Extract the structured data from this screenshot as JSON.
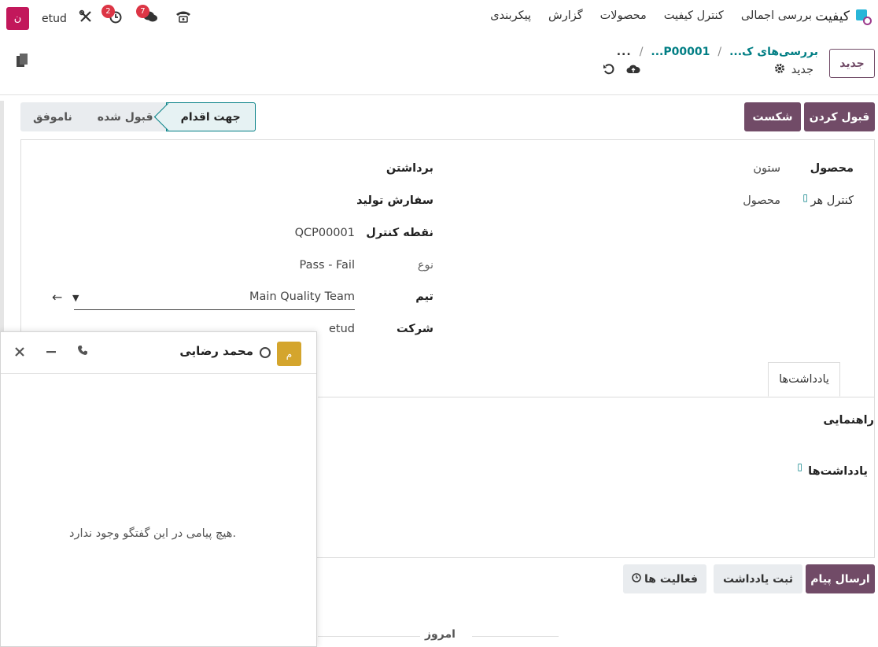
{
  "navbar": {
    "app_name": "کیفیت",
    "menu": [
      "بررسی اجمالی",
      "کنترل کیفیت",
      "محصولات",
      "گزارش",
      "پیکربندی"
    ],
    "user_initial": "ن",
    "db_name": "etud",
    "activity_count": "2",
    "message_count": "7",
    "icons": [
      "tools-icon",
      "clock-icon",
      "chat-icon",
      "phone-icon"
    ]
  },
  "control_panel": {
    "new_label": "جدید",
    "breadcrumb_dots": "...",
    "breadcrumb_1": "بررسی‌های ک...",
    "breadcrumb_2": "P00001...",
    "record_name": "جدید"
  },
  "status": {
    "accept_label": "قبول کردن",
    "fail_label": "شکست",
    "stages": [
      "ناموفق",
      "قبول شده",
      "جهت اقدام"
    ],
    "active_stage": "جهت اقدام"
  },
  "form": {
    "product_label": "محصول",
    "product_value": "ستون",
    "control_per_label": "کنترل هر",
    "control_per_value": "محصول",
    "picking_label": "برداشتن",
    "production_label": "سفارش تولید",
    "point_label": "نقطه کنترل",
    "point_value": "QCP00001",
    "type_label": "نوع",
    "type_value": "Pass - Fail",
    "team_label": "تیم",
    "team_value": "Main Quality Team",
    "company_label": "شرکت",
    "company_value": "etud"
  },
  "tabs": {
    "notes_tab": "یادداشت‌ها",
    "instructions_label": "راهنمایی",
    "notes_label": "یادداشت‌ها"
  },
  "chatter": {
    "send_label": "ارسال پیام",
    "log_label": "ثبت یادداشت",
    "activities_label": "فعالیت ها",
    "today_label": "امروز"
  },
  "chat_window": {
    "avatar_initial": "م",
    "contact_name": "محمد رضایی",
    "empty_message": "هیچ پیامی در این گفتگو وجود ندارد."
  },
  "colors": {
    "primary": "#714b67",
    "link": "#017e84",
    "badge": "#dc3545",
    "user_avatar": "#c2185b",
    "chat_avatar": "#d4a52d"
  }
}
